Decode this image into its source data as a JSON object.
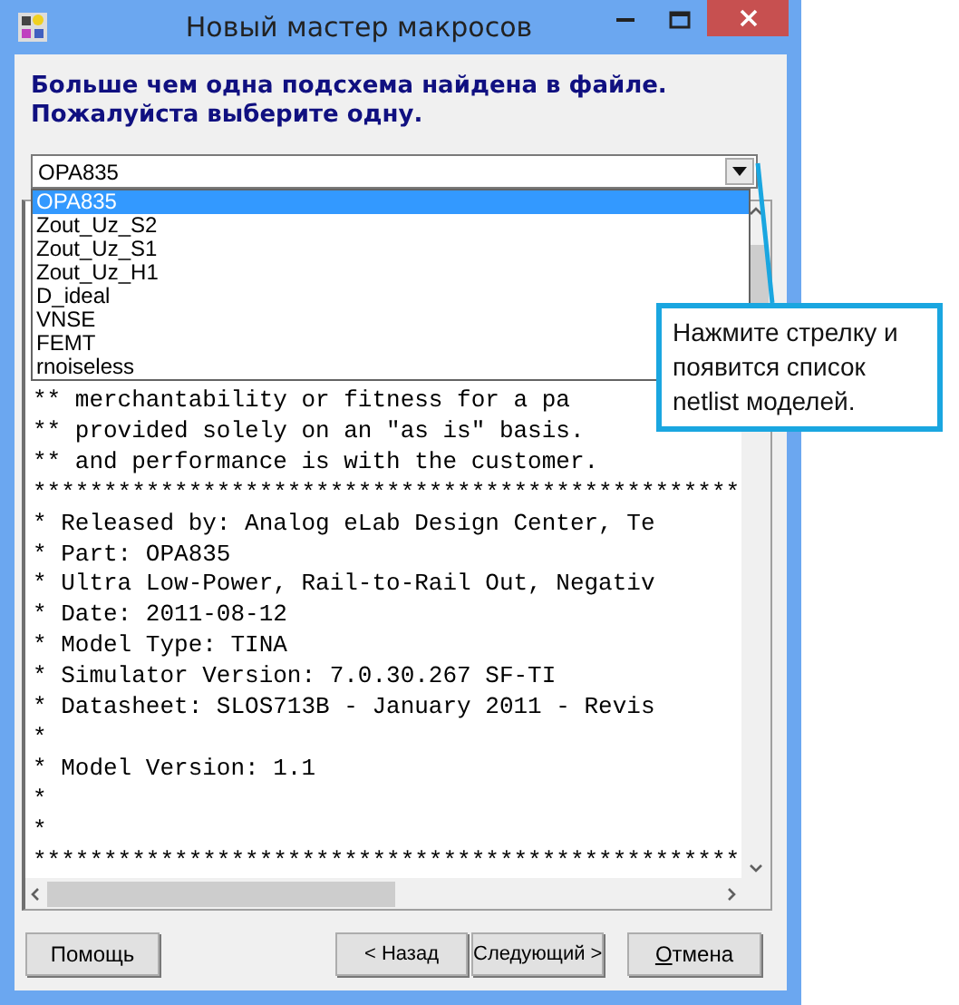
{
  "window": {
    "title": "Новый мастер макросов"
  },
  "heading": [
    "Больше чем одна подсхема найдена в файле.",
    "Пожалуйста выберите одну."
  ],
  "combo": {
    "value": "OPA835",
    "options": [
      {
        "label": "OPA835",
        "selected": true
      },
      {
        "label": "Zout_Uz_S2",
        "selected": false
      },
      {
        "label": "Zout_Uz_S1",
        "selected": false
      },
      {
        "label": "Zout_Uz_H1",
        "selected": false
      },
      {
        "label": "D_ideal",
        "selected": false
      },
      {
        "label": "VNSE",
        "selected": false
      },
      {
        "label": "FEMT",
        "selected": false
      },
      {
        "label": "rnoiseless",
        "selected": false
      }
    ]
  },
  "memo": {
    "lines": [
      "** merchantability or fitness for a pa",
      "** provided solely on an \"as is\" basis.",
      "** and performance is with the customer.",
      "**************************************************",
      "* Released by: Analog eLab Design Center, Te",
      "* Part: OPA835",
      "* Ultra Low-Power, Rail-to-Rail Out, Negativ",
      "* Date: 2011-08-12",
      "* Model Type: TINA",
      "* Simulator Version: 7.0.30.267 SF-TI",
      "* Datasheet: SLOS713B - January 2011 - Revis",
      "*",
      "* Model Version: 1.1",
      "*",
      "*",
      "**************************************************"
    ]
  },
  "help_button": {
    "label": "Помощь"
  },
  "nav_buttons": [
    {
      "label": "< Назад",
      "mnemonic": false
    },
    {
      "label": "Следующий >",
      "mnemonic": false
    }
  ],
  "cancel_button": {
    "label": "Отмена",
    "mnemonic": true
  },
  "callout": {
    "text": "Нажмите стрелку и появится список netlist моделей."
  }
}
